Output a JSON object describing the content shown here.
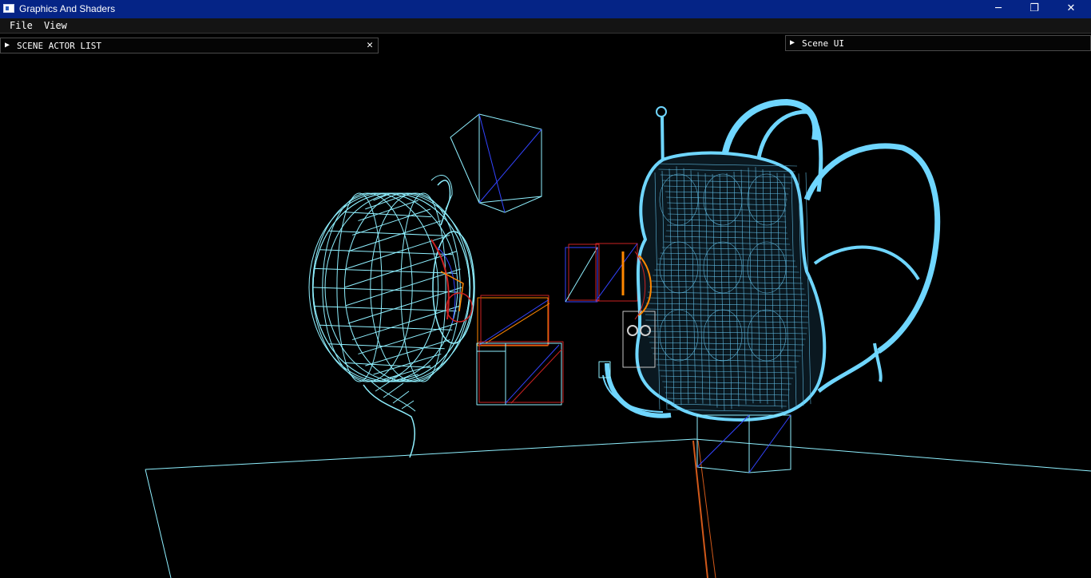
{
  "window": {
    "title": "Graphics And Shaders",
    "icon": "app-window-icon",
    "controls": {
      "minimize": "─",
      "restore": "❐",
      "close": "✕"
    }
  },
  "menubar": {
    "items": [
      "File",
      "View"
    ]
  },
  "panels": {
    "scene_actor_list": {
      "arrow": "▶",
      "title": "SCENE ACTOR LIST",
      "close": "✕"
    },
    "scene_ui": {
      "arrow": "▶",
      "title": "Scene UI"
    }
  },
  "viewport": {
    "background": "#000000",
    "wire_color": "#8ff0ff",
    "accent_colors": [
      "#3344ff",
      "#cc2222",
      "#ff8800"
    ],
    "objects": [
      "teapot",
      "backpack",
      "cube",
      "ground-plane"
    ]
  }
}
